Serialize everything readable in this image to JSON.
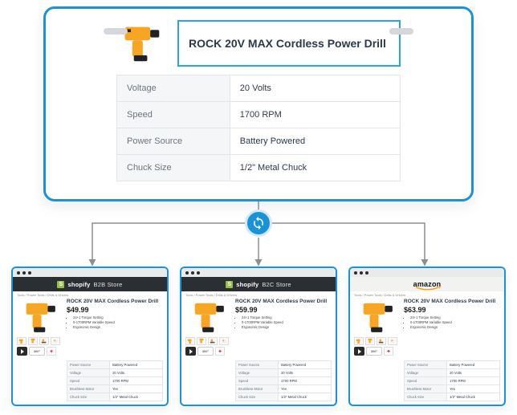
{
  "master": {
    "title": "ROCK 20V MAX Cordless Power Drill",
    "specs": [
      {
        "label": "Voltage",
        "value": "20 Volts"
      },
      {
        "label": "Speed",
        "value": "1700 RPM"
      },
      {
        "label": "Power Source",
        "value": "Battery Powered"
      },
      {
        "label": "Chuck Size",
        "value": "1/2\" Metal Chuck"
      }
    ]
  },
  "sync_icon": "sync",
  "stores": [
    {
      "platform": "shopify",
      "brand_text": "shopify",
      "store_label": "B2B Store",
      "breadcrumbs": "Tools  /  Power Tools  /  Drills & Drivers",
      "product_title": "ROCK 20V MAX Cordless Power Drill",
      "price": "$49.99",
      "bullets": [
        "24+1 Torque Setting",
        "0-1700RPM Variable Speed",
        "Ergonomic Design"
      ],
      "rotate_label": "360°",
      "specs": [
        {
          "label": "Power Source",
          "value": "Battery Powered"
        },
        {
          "label": "Voltage",
          "value": "20 Volts"
        },
        {
          "label": "Speed",
          "value": "1700 RPM"
        },
        {
          "label": "Brushless Motor",
          "value": "Yes"
        },
        {
          "label": "Chuck Size",
          "value": "1/2\" Metal Chuck"
        }
      ]
    },
    {
      "platform": "shopify",
      "brand_text": "shopify",
      "store_label": "B2C Store",
      "breadcrumbs": "Tools  /  Power Tools  /  Drills & Drivers",
      "product_title": "ROCK 20V MAX Cordless Power Drill",
      "price": "$59.99",
      "bullets": [
        "24+1 Torque Setting",
        "0-1700RPM Variable Speed",
        "Ergonomic Design"
      ],
      "rotate_label": "360°",
      "specs": [
        {
          "label": "Power Source",
          "value": "Battery Powered"
        },
        {
          "label": "Voltage",
          "value": "20 Volts"
        },
        {
          "label": "Speed",
          "value": "1700 RPM"
        },
        {
          "label": "Brushless Motor",
          "value": "Yes"
        },
        {
          "label": "Chuck Size",
          "value": "1/2\" Metal Chuck"
        }
      ]
    },
    {
      "platform": "amazon",
      "brand_text": "amazon",
      "store_label": "",
      "breadcrumbs": "Tools  /  Power Tools  /  Drills & Drivers",
      "product_title": "ROCK 20V MAX Cordless Power Drill",
      "price": "$63.99",
      "bullets": [
        "24+1 Torque Setting",
        "0-1700RPM Variable Speed",
        "Ergonomic Design"
      ],
      "rotate_label": "360°",
      "specs": [
        {
          "label": "Power Source",
          "value": "Battery Powered"
        },
        {
          "label": "Voltage",
          "value": "20 Volts"
        },
        {
          "label": "Speed",
          "value": "1700 RPM"
        },
        {
          "label": "Brushless Motor",
          "value": "Yes"
        },
        {
          "label": "Chuck Size",
          "value": "1/2\" Metal Chuck"
        }
      ]
    }
  ]
}
